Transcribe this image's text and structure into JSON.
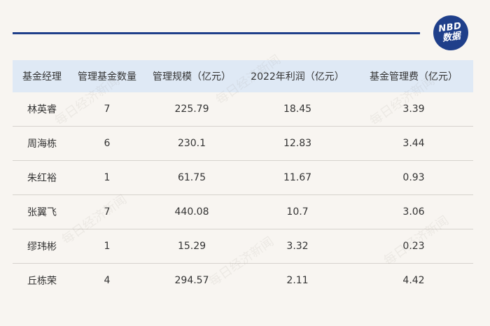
{
  "badge": {
    "line1": "NBD",
    "line2": "数据"
  },
  "table": {
    "headers": [
      "基金经理",
      "管理基金数量",
      "管理规模（亿元）",
      "2022年利润（亿元）",
      "基金管理费（亿元）"
    ],
    "rows": [
      [
        "林英睿",
        "7",
        "225.79",
        "18.45",
        "3.39"
      ],
      [
        "周海栋",
        "6",
        "230.1",
        "12.83",
        "3.44"
      ],
      [
        "朱红裕",
        "1",
        "61.75",
        "11.67",
        "0.93"
      ],
      [
        "张翼飞",
        "7",
        "440.08",
        "10.7",
        "3.06"
      ],
      [
        "缪玮彬",
        "1",
        "15.29",
        "3.32",
        "0.23"
      ],
      [
        "丘栋荣",
        "4",
        "294.57",
        "2.11",
        "4.42"
      ]
    ]
  },
  "watermark": {
    "text": "每日经济新闻"
  },
  "colors": {
    "brand": "#1f3f8a",
    "header_bg": "#dfe9f5",
    "page_bg": "#f8f5f1"
  }
}
